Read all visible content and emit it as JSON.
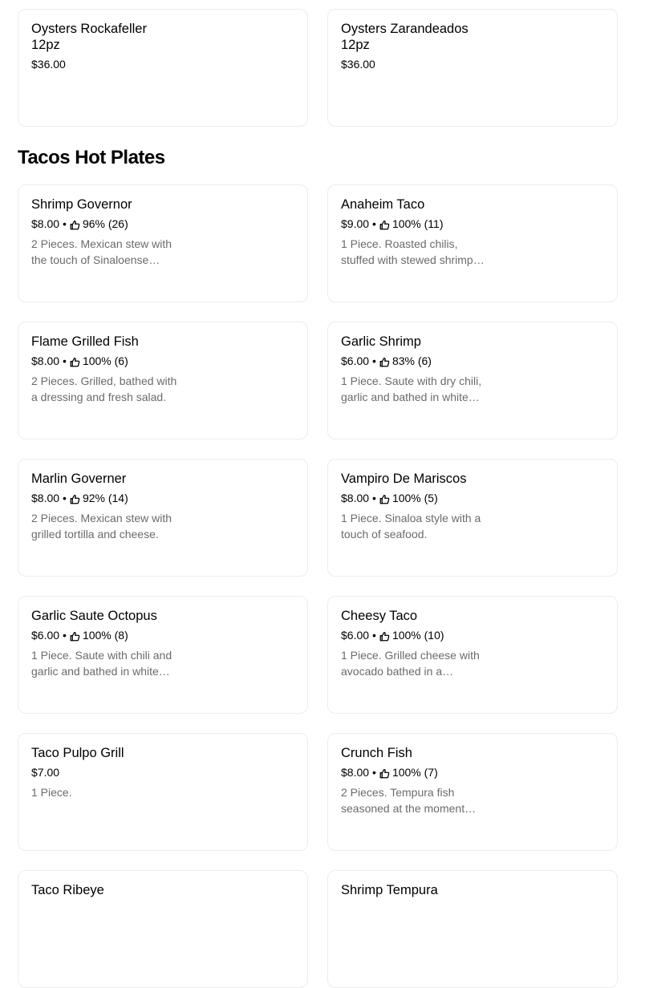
{
  "top_items": [
    {
      "name": "Oysters Rockafeller\n12pz",
      "price": "$36.00"
    },
    {
      "name": "Oysters Zarandeados\n12pz",
      "price": "$36.00"
    }
  ],
  "section": {
    "title": "Tacos Hot Plates",
    "items": [
      {
        "name": "Shrimp Governor",
        "price": "$8.00",
        "rating": "96% (26)",
        "description": "2 Pieces. Mexican stew with the touch of Sinaloense…"
      },
      {
        "name": "Anaheim Taco",
        "price": "$9.00",
        "rating": "100% (11)",
        "description": "1 Piece. Roasted chilis, stuffed with stewed shrimp…"
      },
      {
        "name": "Flame Grilled Fish",
        "price": "$8.00",
        "rating": "100% (6)",
        "description": "2 Pieces. Grilled, bathed with a dressing and fresh salad."
      },
      {
        "name": "Garlic Shrimp",
        "price": "$6.00",
        "rating": "83% (6)",
        "description": "1 Piece. Saute with dry chili, garlic and bathed in white…"
      },
      {
        "name": "Marlin Governer",
        "price": "$8.00",
        "rating": "92% (14)",
        "description": "2 Pieces. Mexican stew with grilled tortilla and cheese."
      },
      {
        "name": "Vampiro De Mariscos",
        "price": "$8.00",
        "rating": "100% (5)",
        "description": "1 Piece. Sinaloa style with a touch of seafood."
      },
      {
        "name": "Garlic Saute Octopus",
        "price": "$6.00",
        "rating": "100% (8)",
        "description": "1 Piece. Saute with chili and garlic and bathed in white…"
      },
      {
        "name": "Cheesy Taco",
        "price": "$6.00",
        "rating": "100% (10)",
        "description": "1 Piece. Grilled cheese with avocado bathed in a…"
      },
      {
        "name": "Taco Pulpo Grill",
        "price": "$7.00",
        "description": "1 Piece."
      },
      {
        "name": "Crunch Fish",
        "price": "$8.00",
        "rating": "100% (7)",
        "description": "2 Pieces. Tempura fish seasoned at the moment…"
      },
      {
        "name": "Taco Ribeye"
      },
      {
        "name": "Shrimp Tempura"
      }
    ]
  },
  "icons": {
    "rating": "thumbs-up-icon",
    "separator": "•"
  },
  "colors": {
    "text": "#000000",
    "muted": "#6b6b6b",
    "border": "#ececec"
  }
}
